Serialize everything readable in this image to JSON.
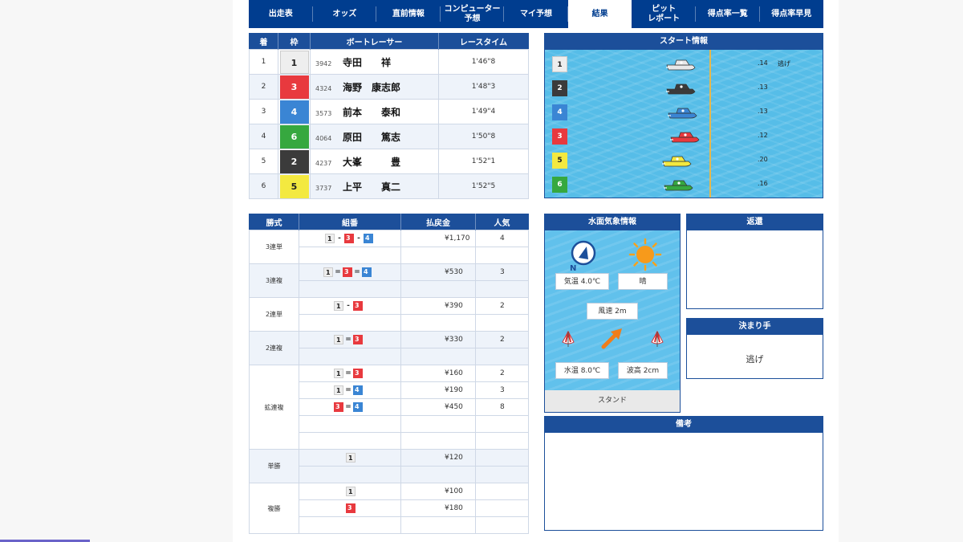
{
  "tabs": [
    {
      "label": "出走表",
      "active": false
    },
    {
      "label": "オッズ",
      "active": false
    },
    {
      "label": "直前情報",
      "active": false
    },
    {
      "label": "コンピューター\n予想",
      "active": false
    },
    {
      "label": "マイ予想",
      "active": false
    },
    {
      "label": "結果",
      "active": true
    },
    {
      "label": "ピット\nレポート",
      "active": false
    },
    {
      "label": "得点率一覧",
      "active": false
    },
    {
      "label": "得点率早見",
      "active": false
    }
  ],
  "result": {
    "headers": [
      "着",
      "枠",
      "ボートレーサー",
      "レースタイム"
    ],
    "rows": [
      {
        "rank": "1",
        "waku": "1",
        "num": "3942",
        "name": "寺田　　祥",
        "time": "1'46\"8"
      },
      {
        "rank": "2",
        "waku": "3",
        "num": "4324",
        "name": "海野　康志郎",
        "time": "1'48\"3"
      },
      {
        "rank": "3",
        "waku": "4",
        "num": "3573",
        "name": "前本　　泰和",
        "time": "1'49\"4"
      },
      {
        "rank": "4",
        "waku": "6",
        "num": "4064",
        "name": "原田　　篤志",
        "time": "1'50\"8"
      },
      {
        "rank": "5",
        "waku": "2",
        "num": "4237",
        "name": "大峯　　　豊",
        "time": "1'52\"1"
      },
      {
        "rank": "6",
        "waku": "5",
        "num": "3737",
        "name": "上平　　真二",
        "time": "1'52\"5"
      }
    ]
  },
  "start_info": {
    "title": "スタート情報",
    "rows": [
      {
        "course": "1",
        "st": ".14",
        "kimarite": "逃げ",
        "color": "#e9e9e9"
      },
      {
        "course": "2",
        "st": ".13",
        "kimarite": "",
        "color": "#3b3b3b"
      },
      {
        "course": "4",
        "st": ".13",
        "kimarite": "",
        "color": "#3a85d4"
      },
      {
        "course": "3",
        "st": ".12",
        "kimarite": "",
        "color": "#e8393e"
      },
      {
        "course": "5",
        "st": ".20",
        "kimarite": "",
        "color": "#f3e940"
      },
      {
        "course": "6",
        "st": ".16",
        "kimarite": "",
        "color": "#36a83f"
      }
    ]
  },
  "payout": {
    "headers": [
      "勝式",
      "組番",
      "払戻金",
      "人気"
    ],
    "groups": [
      {
        "type": "3連単",
        "rows": [
          {
            "combo": [
              "1",
              "3",
              "4"
            ],
            "sep": [
              "-",
              "-"
            ],
            "amount": "¥1,170",
            "pop": "4"
          },
          {
            "combo": [],
            "sep": [],
            "amount": "",
            "pop": ""
          }
        ]
      },
      {
        "type": "3連複",
        "rows": [
          {
            "combo": [
              "1",
              "3",
              "4"
            ],
            "sep": [
              "=",
              "="
            ],
            "amount": "¥530",
            "pop": "3"
          },
          {
            "combo": [],
            "sep": [],
            "amount": "",
            "pop": ""
          }
        ]
      },
      {
        "type": "2連単",
        "rows": [
          {
            "combo": [
              "1",
              "3"
            ],
            "sep": [
              "-"
            ],
            "amount": "¥390",
            "pop": "2"
          },
          {
            "combo": [],
            "sep": [],
            "amount": "",
            "pop": ""
          }
        ]
      },
      {
        "type": "2連複",
        "rows": [
          {
            "combo": [
              "1",
              "3"
            ],
            "sep": [
              "="
            ],
            "amount": "¥330",
            "pop": "2"
          },
          {
            "combo": [],
            "sep": [],
            "amount": "",
            "pop": ""
          }
        ]
      },
      {
        "type": "拡連複",
        "rows": [
          {
            "combo": [
              "1",
              "3"
            ],
            "sep": [
              "="
            ],
            "amount": "¥160",
            "pop": "2"
          },
          {
            "combo": [
              "1",
              "4"
            ],
            "sep": [
              "="
            ],
            "amount": "¥190",
            "pop": "3"
          },
          {
            "combo": [
              "3",
              "4"
            ],
            "sep": [
              "="
            ],
            "amount": "¥450",
            "pop": "8"
          },
          {
            "combo": [],
            "sep": [],
            "amount": "",
            "pop": ""
          },
          {
            "combo": [],
            "sep": [],
            "amount": "",
            "pop": ""
          }
        ]
      },
      {
        "type": "単勝",
        "rows": [
          {
            "combo": [
              "1"
            ],
            "sep": [],
            "amount": "¥120",
            "pop": ""
          },
          {
            "combo": [],
            "sep": [],
            "amount": "",
            "pop": ""
          }
        ]
      },
      {
        "type": "複勝",
        "rows": [
          {
            "combo": [
              "1"
            ],
            "sep": [],
            "amount": "¥100",
            "pop": ""
          },
          {
            "combo": [
              "3"
            ],
            "sep": [],
            "amount": "¥180",
            "pop": ""
          },
          {
            "combo": [],
            "sep": [],
            "amount": "",
            "pop": ""
          }
        ]
      }
    ]
  },
  "weather": {
    "title": "水面気象情報",
    "compass_label": "N",
    "air_temp": "気温 4.0℃",
    "condition": "晴",
    "wind_speed": "風速 2m",
    "water_temp": "水温 8.0℃",
    "wave_height": "波高 2cm",
    "footer": "スタンド"
  },
  "henkan": {
    "title": "返還"
  },
  "kimarite": {
    "title": "決まり手",
    "value": "逃げ"
  },
  "biko": {
    "title": "備考"
  }
}
